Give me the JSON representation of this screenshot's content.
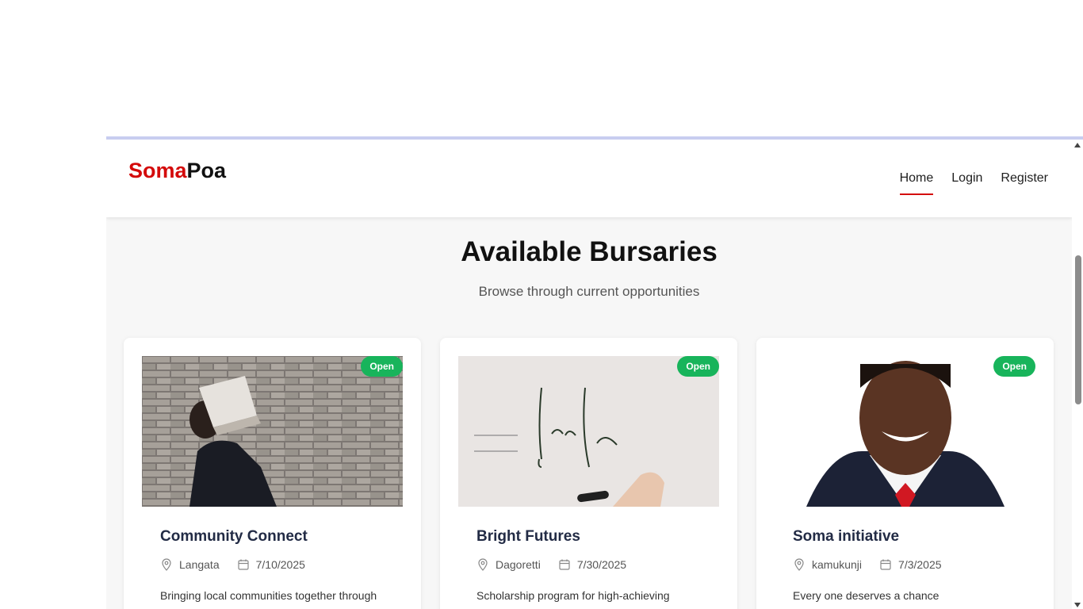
{
  "brand": {
    "part1": "Soma",
    "part2": "Poa"
  },
  "nav": {
    "home": "Home",
    "login": "Login",
    "register": "Register"
  },
  "page": {
    "title": "Available Bursaries",
    "subtitle": "Browse through current opportunities"
  },
  "cards": [
    {
      "title": "Community Connect",
      "location": "Langata",
      "date": "7/10/2025",
      "status": "Open",
      "description": "Bringing local communities together through"
    },
    {
      "title": "Bright Futures",
      "location": "Dagoretti",
      "date": "7/30/2025",
      "status": "Open",
      "description": "Scholarship program for high-achieving"
    },
    {
      "title": "Soma initiative",
      "location": "kamukunji",
      "date": "7/3/2025",
      "status": "Open",
      "description": "Every one deserves a chance"
    }
  ],
  "colors": {
    "brand_red": "#d40b0b",
    "badge_green": "#18b45b"
  },
  "icons": {
    "location": "map-pin-icon",
    "date": "calendar-icon"
  }
}
